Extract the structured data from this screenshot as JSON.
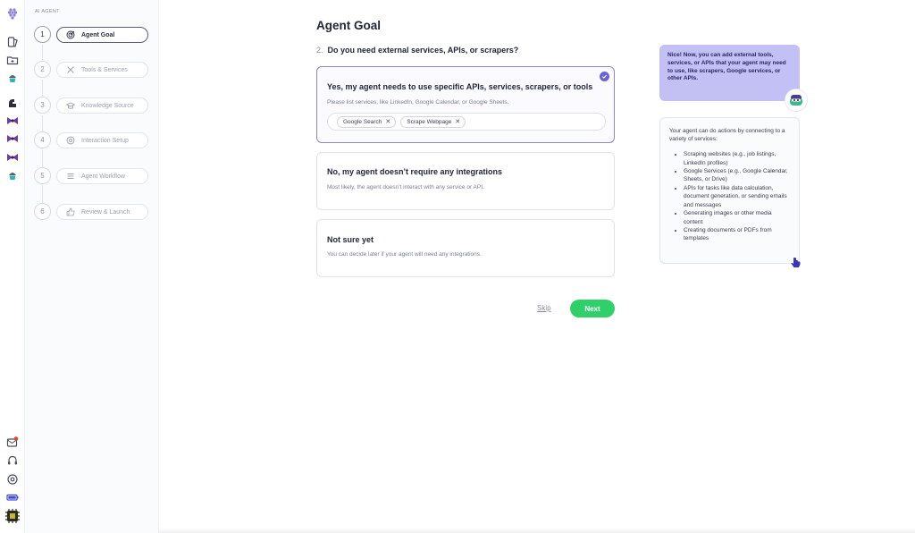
{
  "rail": {
    "icons": [
      "logo-icon",
      "book-icon",
      "folder-icon",
      "cupcake-icon",
      "flex-arm-icon",
      "bow-icon",
      "bow-icon",
      "bow-icon",
      "cupcake-icon"
    ],
    "bottom_icons": [
      "notification-icon",
      "headset-icon",
      "settings-icon",
      "battery-icon",
      "chip-icon"
    ]
  },
  "sidebar": {
    "section_label": "AI AGENT",
    "steps": [
      {
        "num": "1",
        "label": "Agent Goal",
        "icon": "target-icon",
        "active": true
      },
      {
        "num": "2",
        "label": "Tools & Services",
        "icon": "tools-icon",
        "active": false
      },
      {
        "num": "3",
        "label": "Knowledge Source",
        "icon": "graduation-cap-icon",
        "active": false
      },
      {
        "num": "4",
        "label": "Interaction Setup",
        "icon": "settings-circle-icon",
        "active": false
      },
      {
        "num": "5",
        "label": "Agent Workflow",
        "icon": "list-icon",
        "active": false
      },
      {
        "num": "6",
        "label": "Review & Launch",
        "icon": "thumbs-up-icon",
        "active": false
      }
    ]
  },
  "main": {
    "title": "Agent Goal",
    "question_number": "2.",
    "question": "Do you need external services, APIs, or scrapers?",
    "options": [
      {
        "title": "Yes, my agent needs to use specific APIs, services, scrapers, or tools",
        "description": "Please list services, like LinkedIn, Google Calendar, or Google Sheets.",
        "selected": true,
        "tags": [
          "Google Search",
          "Scrape Webpage"
        ]
      },
      {
        "title": "No, my agent doesn’t require any integrations",
        "description": "Most likely, the agent doesn’t interact with any service or API.",
        "selected": false
      },
      {
        "title": "Not sure yet",
        "description": "You can decide later if your agent will need any integrations.",
        "selected": false
      }
    ],
    "skip_label": "Skip",
    "next_label": "Next"
  },
  "assistant": {
    "bubble_text": "Nice! Now, you can add external tools, services, or APIs that your agent may need to use, like scrapers, Google services, or other APIs.",
    "info_intro": "Your agent can do actions by connecting to a variety of services:",
    "info_items": [
      "Scraping websites (e.g., job listings, LinkedIn profiles)",
      "Google Services (e.g., Google Calendar, Sheets, or Drive)",
      "APIs for tasks like data calculation, document generation, or sending emails and messages",
      "Generating images or other media content",
      "Creating documents or PDFs from templates"
    ]
  },
  "colors": {
    "accent": "#6a63d6",
    "next_button": "#2fd069",
    "bubble": "#c3c0f5"
  }
}
